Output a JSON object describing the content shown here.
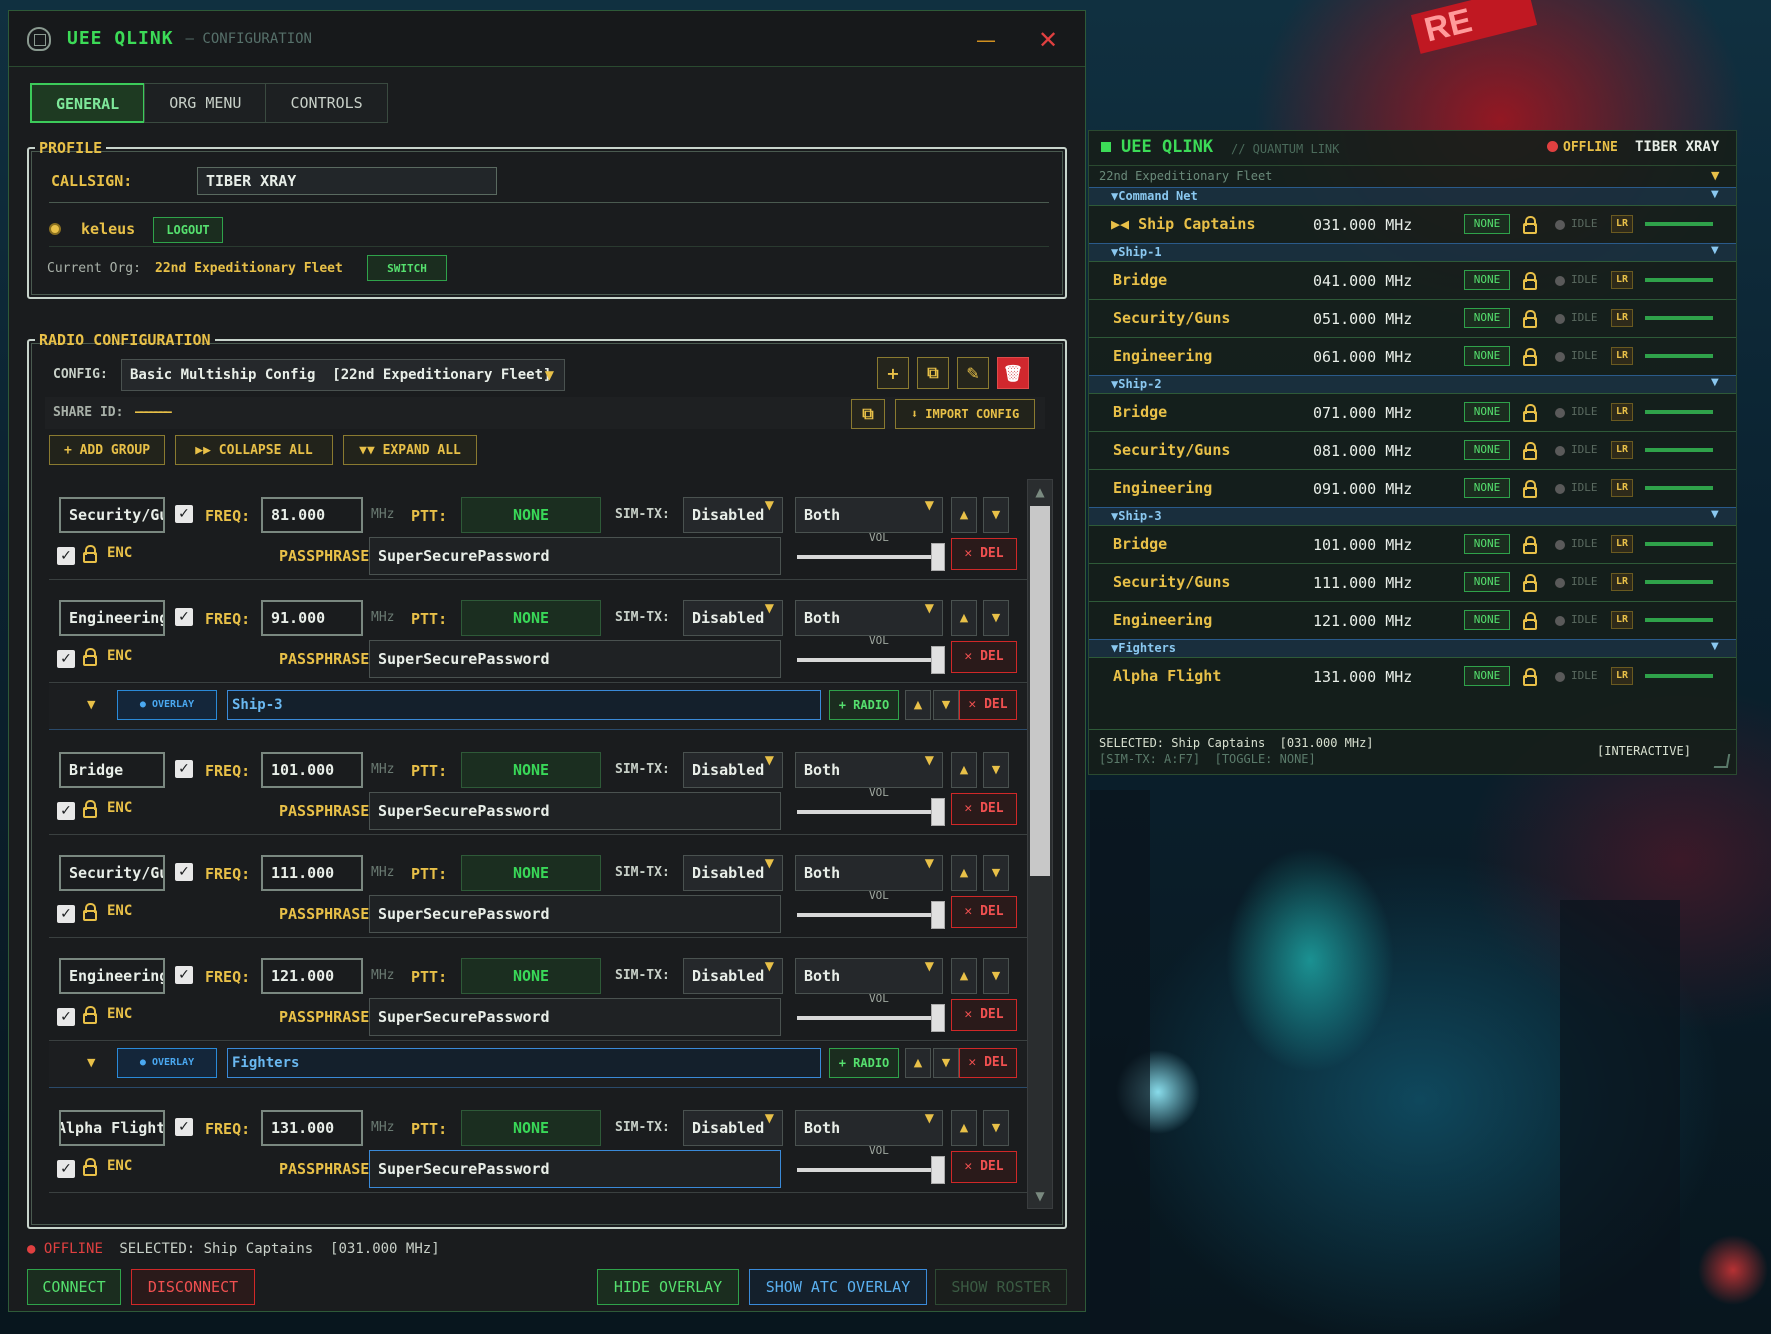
{
  "window": {
    "app_name": "UEE QLINK",
    "subtitle": "— CONFIGURATION",
    "minimize": "—",
    "close": "✕"
  },
  "tabs": [
    "GENERAL",
    "ORG MENU",
    "CONTROLS"
  ],
  "profile": {
    "legend": "PROFILE",
    "callsign_label": "CALLSIGN:",
    "callsign_value": "TIBER XRAY",
    "user": "keleus",
    "logout": "LOGOUT",
    "org_label": "Current Org:",
    "org_value": "22nd Expeditionary Fleet",
    "switch": "SWITCH"
  },
  "radio_config": {
    "legend": "RADIO CONFIGURATION",
    "config_label": "CONFIG:",
    "config_value": "Basic Multiship Config  [22nd Expeditionary Fleet]",
    "share_label": "SHARE ID:",
    "share_value": "———————",
    "import": "⬇ IMPORT CONFIG",
    "add_group": "+ ADD GROUP",
    "collapse_all": "▶▶ COLLAPSE ALL",
    "expand_all": "▼▼ EXPAND ALL"
  },
  "labels": {
    "freq": "FREQ:",
    "mhz": "MHz",
    "ptt": "PTT:",
    "simtx": "SIM-TX:",
    "enc": "ENC",
    "passphrase": "PASSPHRASE:",
    "vol": "VOL",
    "del": "✕ DEL",
    "overlay": "● OVERLAY",
    "add_radio": "+ RADIO",
    "up": "▲",
    "down": "▼"
  },
  "radios": [
    {
      "name": "Security/Guns",
      "freq": "81.000",
      "ptt": "NONE",
      "simtx": "Disabled",
      "mode": "Both",
      "pass": "SuperSecurePassword"
    },
    {
      "name": "Engineering",
      "freq": "91.000",
      "ptt": "NONE",
      "simtx": "Disabled",
      "mode": "Both",
      "pass": "SuperSecurePassword"
    },
    {
      "name": "Bridge",
      "freq": "101.000",
      "ptt": "NONE",
      "simtx": "Disabled",
      "mode": "Both",
      "pass": "SuperSecurePassword"
    },
    {
      "name": "Security/Guns",
      "freq": "111.000",
      "ptt": "NONE",
      "simtx": "Disabled",
      "mode": "Both",
      "pass": "SuperSecurePassword"
    },
    {
      "name": "Engineering",
      "freq": "121.000",
      "ptt": "NONE",
      "simtx": "Disabled",
      "mode": "Both",
      "pass": "SuperSecurePassword"
    },
    {
      "name": "Alpha Flight",
      "freq": "131.000",
      "ptt": "NONE",
      "simtx": "Disabled",
      "mode": "Both",
      "pass": "SuperSecurePassword"
    }
  ],
  "groups": [
    "Ship-3",
    "Fighters"
  ],
  "status": {
    "dot": "●",
    "offline": "OFFLINE",
    "selected": "SELECTED: Ship Captains  [031.000 MHz]"
  },
  "bottom": {
    "connect": "CONNECT",
    "disconnect": "DISCONNECT",
    "hide_overlay": "HIDE OVERLAY",
    "show_atc": "SHOW ATC OVERLAY",
    "show_roster": "SHOW ROSTER"
  },
  "overlay": {
    "title": "UEE QLINK",
    "subtitle": "// QUANTUM LINK",
    "status": "OFFLINE",
    "callsign": "TIBER XRAY",
    "org": "22nd Expeditionary Fleet",
    "groups": [
      {
        "name": "▼Command Net",
        "channels": [
          {
            "name": "▶◀ Ship Captains",
            "freq": "031.000 MHz"
          }
        ]
      },
      {
        "name": "▼Ship-1",
        "channels": [
          {
            "name": "Bridge",
            "freq": "041.000 MHz"
          },
          {
            "name": "Security/Guns",
            "freq": "051.000 MHz"
          },
          {
            "name": "Engineering",
            "freq": "061.000 MHz"
          }
        ]
      },
      {
        "name": "▼Ship-2",
        "channels": [
          {
            "name": "Bridge",
            "freq": "071.000 MHz"
          },
          {
            "name": "Security/Guns",
            "freq": "081.000 MHz"
          },
          {
            "name": "Engineering",
            "freq": "091.000 MHz"
          }
        ]
      },
      {
        "name": "▼Ship-3",
        "channels": [
          {
            "name": "Bridge",
            "freq": "101.000 MHz"
          },
          {
            "name": "Security/Guns",
            "freq": "111.000 MHz"
          },
          {
            "name": "Engineering",
            "freq": "121.000 MHz"
          }
        ]
      },
      {
        "name": "▼Fighters",
        "channels": [
          {
            "name": "Alpha Flight",
            "freq": "131.000 MHz"
          }
        ]
      }
    ],
    "ch_ptt": "NONE",
    "ch_idle": "IDLE",
    "ch_lr": "LR",
    "footer_selected": "SELECTED: Ship Captains  [031.000 MHz]",
    "footer_keys": "[SIM-TX: A:F7]  [TOGGLE: NONE]",
    "footer_mode": "[INTERACTIVE]"
  },
  "colors": {
    "accent_green": "#3cdb57",
    "accent_yellow": "#e8c048",
    "danger": "#e04040",
    "info": "#3a8ad8"
  }
}
